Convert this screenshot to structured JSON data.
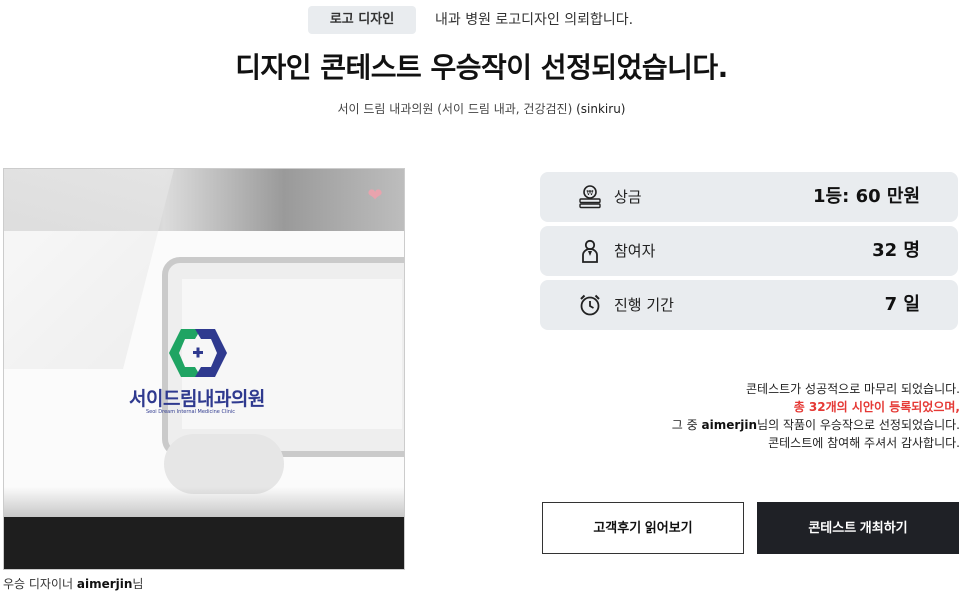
{
  "category": {
    "badge": "로고 디자인",
    "description": "내과 병원 로고디자인 의뢰합니다."
  },
  "headline": "디자인 콘테스트 우승작이 선정되었습니다.",
  "client": {
    "text": "서이 드림 내과의원 (서이 드림 내과, 건강검진)",
    "user_id": "(sinkiru)"
  },
  "winner_image": {
    "logo_title": "서이드림내과의원",
    "logo_subtitle": "Seoi Dream Internal Medicine Clinic",
    "heart_icon": "heart-icon"
  },
  "winner_caption": {
    "prefix": "우승 디자이너 ",
    "designer": "aimerjin",
    "suffix": "님"
  },
  "stats": [
    {
      "icon": "money-icon",
      "label": "상금",
      "value": "1등: 60 만원"
    },
    {
      "icon": "person-icon",
      "label": "참여자",
      "value": "32 명"
    },
    {
      "icon": "alarm-clock-icon",
      "label": "진행 기간",
      "value": "7 일"
    }
  ],
  "message": {
    "line1": "콘테스트가 성공적으로 마무리 되었습니다.",
    "line2": "총 32개의 시안이 등록되었으며,",
    "line3_prefix": "그 중 ",
    "line3_designer": "aimerjin",
    "line3_suffix": "님의 작품이 우승작으로 선정되었습니다.",
    "line4": "콘테스트에 참여해 주셔서 감사합니다."
  },
  "buttons": {
    "reviews": "고객후기 읽어보기",
    "host": "콘테스트 개최하기"
  },
  "colors": {
    "accent_red": "#e53935",
    "dark_button": "#1f2126",
    "stat_bg": "#e9ecef",
    "logo_blue": "#2f3a8f",
    "logo_green": "#1fa463"
  }
}
